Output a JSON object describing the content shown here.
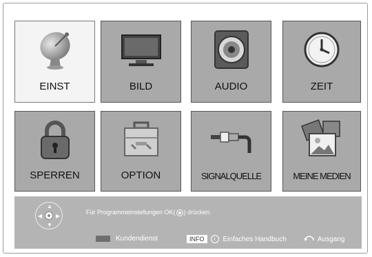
{
  "menu": {
    "items": [
      {
        "label": "EINST",
        "icon": "satellite-dish-icon",
        "selected": true
      },
      {
        "label": "BILD",
        "icon": "tv-screen-icon",
        "selected": false
      },
      {
        "label": "AUDIO",
        "icon": "speaker-icon",
        "selected": false
      },
      {
        "label": "ZEIT",
        "icon": "clock-icon",
        "selected": false
      },
      {
        "label": "SPERREN",
        "icon": "padlock-icon",
        "selected": false
      },
      {
        "label": "OPTION",
        "icon": "toolbox-icon",
        "selected": false
      },
      {
        "label": "SIGNALQUELLE",
        "icon": "cable-connector-icon",
        "selected": false
      },
      {
        "label": "MEINE MEDIEN",
        "icon": "media-photos-icon",
        "selected": false
      }
    ]
  },
  "footer": {
    "hint_prefix": "Für Programmeinstellungen OK(",
    "hint_suffix": ") drücken.",
    "service_label": "Kundendienst",
    "info_key": "INFO",
    "info_symbol": "i",
    "manual_label": "Einfaches Handbuch",
    "exit_label": "Ausgang"
  },
  "colors": {
    "tile": "#a9a9a9",
    "tile_selected": "#f4f4f4",
    "footer": "#b4b4b4"
  }
}
